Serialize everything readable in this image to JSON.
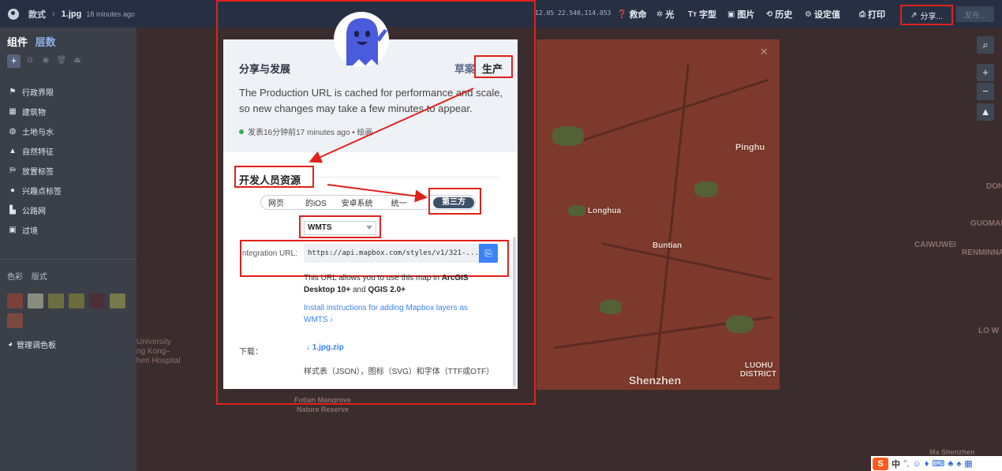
{
  "topbar": {
    "folder": "款式",
    "file": "1.jpg",
    "time": "18 minutes ago",
    "coords": "12.05 22.540,114.053",
    "items": [
      {
        "icon": "help-icon",
        "label": "救命"
      },
      {
        "icon": "light-icon",
        "label": "光"
      },
      {
        "icon": "font-icon",
        "label": "字型"
      },
      {
        "icon": "image-icon",
        "label": "图片"
      },
      {
        "icon": "history-icon",
        "label": "历史"
      },
      {
        "icon": "settings-icon",
        "label": "设定值"
      },
      {
        "icon": "print-icon",
        "label": "打印"
      }
    ],
    "share": "分享...",
    "publish": "发布..."
  },
  "sidebar": {
    "tab_components": "组件",
    "tab_layers": "层数",
    "layers": [
      "行政界限",
      "建筑物",
      "土地与水",
      "自然特征",
      "放置标签",
      "兴趣点标签",
      "公路网",
      "过境"
    ],
    "color_tab": "色彩",
    "style_tab": "版式",
    "swatches": [
      "#7d4038",
      "#8a8c80",
      "#6b6e40",
      "#6a6c3c",
      "#4a2f38",
      "#757a48",
      "#7a4a3e"
    ],
    "manage": "管理调色板"
  },
  "map": {
    "labels": {
      "pinghu": "Pinghu",
      "longhua": "Longhua",
      "buntian": "Buntian",
      "shenzhen": "Shenzhen",
      "luohu1": "LUOHU",
      "luohu2": "DISTRICT",
      "caiwuwei": "CAIWUWEI",
      "renminna": "RENMINNA",
      "guoman": "GUOMAN",
      "dong": "DON",
      "lowu": "LO W",
      "university": "University",
      "kong": "ng Kong–",
      "hospital": "hen Hospital",
      "futian1": "Futian Mangrove",
      "futian2": "Nature Reserve",
      "shenzhen2": "Ma Shenzhen"
    }
  },
  "modal": {
    "title": "分享与发展",
    "env_draft": "草案",
    "env_prod": "生产",
    "desc": "The Production URL is cached for performance and scale, so new changes may take a few minutes to appear.",
    "status": "发表16分钟前17 minutes ago • 绘画",
    "section_title": "开发人员资源",
    "platforms": [
      "网页",
      "的iOS",
      "安卓系统",
      "统一"
    ],
    "platform_active": "第三方",
    "select_value": "WMTS",
    "integration_label": "Integration URL:",
    "integration_url": "https://api.mapbox.com/styles/v1/321-...",
    "info_prefix": "This URL allows you to use this map in ",
    "info_arcgis": "ArcGIS Desktop 10+",
    "info_and": " and ",
    "info_qgis": "QGIS 2.0+",
    "install": "Install instructions for adding Mapbox layers as WMTS",
    "download_label": "下载：",
    "download_file": "1.jpg.zip",
    "download_note": "样式表（JSON），图标（SVG）和字体（TTF或OTF）"
  },
  "ime": {
    "logo": "S",
    "mode": "中"
  }
}
